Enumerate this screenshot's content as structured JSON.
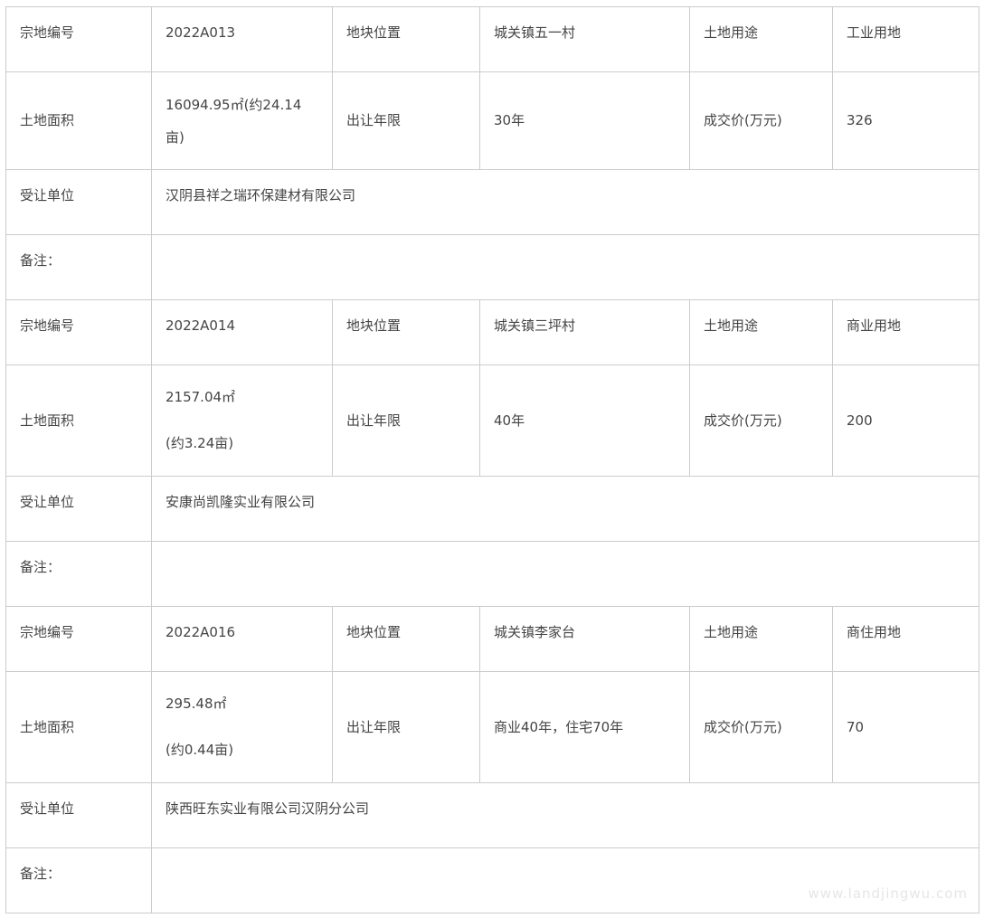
{
  "parcels": [
    {
      "row1": {
        "l1": "宗地编号",
        "v1": "2022A013",
        "l2": "地块位置",
        "v2": "城关镇五一村",
        "l3": "土地用途",
        "v3": "工业用地"
      },
      "row2": {
        "l1": "土地面积",
        "v1a": "16094.95㎡(约24.14",
        "v1b": "亩)",
        "l2": "出让年限",
        "v2": "30年",
        "l3": "成交价(万元)",
        "v3": "326"
      },
      "row3": {
        "l": "受让单位",
        "v": "汉阴县祥之瑞环保建材有限公司"
      },
      "row4": {
        "l": "备注：",
        "v": ""
      }
    },
    {
      "row1": {
        "l1": "宗地编号",
        "v1": "2022A014",
        "l2": "地块位置",
        "v2": "城关镇三坪村",
        "l3": "土地用途",
        "v3": "商业用地"
      },
      "row2": {
        "l1": "土地面积",
        "v1a": "2157.04㎡",
        "v1b": "(约3.24亩)",
        "l2": "出让年限",
        "v2": "40年",
        "l3": "成交价(万元)",
        "v3": "200"
      },
      "row3": {
        "l": "受让单位",
        "v": "安康尚凯隆实业有限公司"
      },
      "row4": {
        "l": "备注：",
        "v": ""
      }
    },
    {
      "row1": {
        "l1": "宗地编号",
        "v1": "2022A016",
        "l2": "地块位置",
        "v2": "城关镇李家台",
        "l3": "土地用途",
        "v3": "商住用地"
      },
      "row2": {
        "l1": "土地面积",
        "v1a": "295.48㎡",
        "v1b": "(约0.44亩)",
        "l2": "出让年限",
        "v2": "商业40年，住宅70年",
        "l3": "成交价(万元)",
        "v3": "70"
      },
      "row3": {
        "l": "受让单位",
        "v": "陕西旺东实业有限公司汉阴分公司"
      },
      "row4": {
        "l": "备注：",
        "v": ""
      }
    }
  ],
  "watermark": "www.landjingwu.com"
}
